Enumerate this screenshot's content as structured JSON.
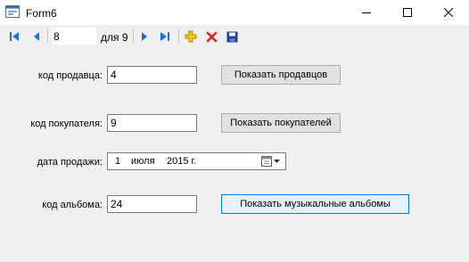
{
  "window": {
    "title": "Form6"
  },
  "navigator": {
    "position": "8",
    "count_label": "для 9"
  },
  "form": {
    "seller_label": "код продавца:",
    "seller_value": "4",
    "show_sellers": "Показать продавцов",
    "buyer_label": "код покупателя:",
    "buyer_value": "9",
    "show_buyers": "Показать покупателей",
    "date_label": "дата продажи:",
    "date_day": "1",
    "date_month": "июля",
    "date_year": "2015 г.",
    "album_label": "код альбома:",
    "album_value": "24",
    "show_albums": "Показать музыкальные альбомы"
  },
  "colors": {
    "nav_blue": "#1e6fd9",
    "add_yellow": "#e8b100",
    "delete_red": "#e01e1e",
    "save_navy": "#1f3f8f",
    "focus_border": "#0078d7"
  },
  "icons": [
    "form-icon",
    "minimize-icon",
    "maximize-icon",
    "close-icon",
    "move-first-icon",
    "move-previous-icon",
    "move-next-icon",
    "move-last-icon",
    "add-icon",
    "delete-icon",
    "save-icon",
    "calendar-icon",
    "chevron-down-icon"
  ]
}
